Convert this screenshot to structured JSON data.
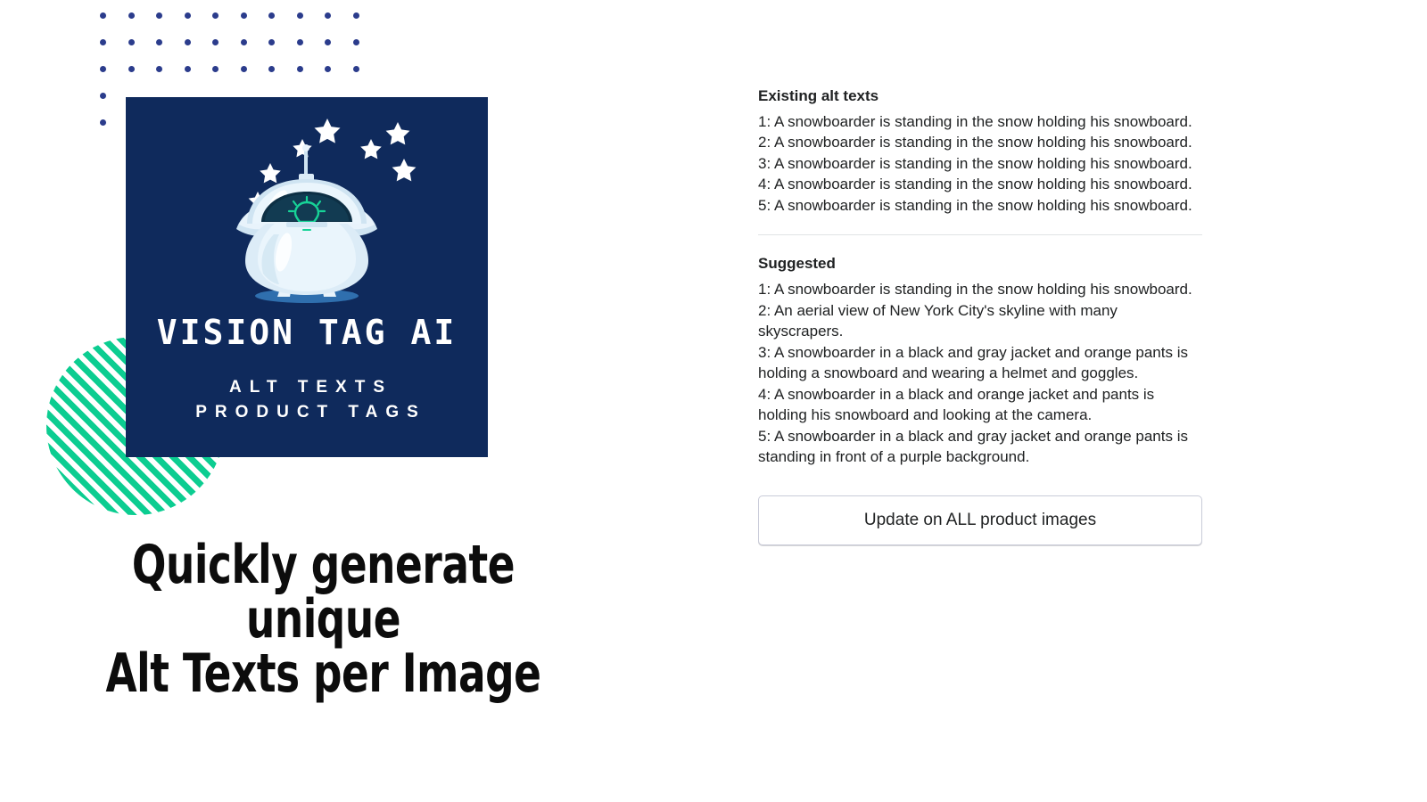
{
  "promo": {
    "card": {
      "title": "VISION TAG AI",
      "subtitle_line_1": "ALT TEXTS",
      "subtitle_line_2": "PRODUCT TAGS",
      "background_color": "#0f2a5c",
      "mascot": "robot-mascot-icon"
    },
    "decorations": {
      "dot_grid_color": "#2b3c8c",
      "striped_circle_color": "#0ccd91"
    },
    "headline_line_1": "Quickly generate unique",
    "headline_line_2": "Alt Texts per Image"
  },
  "alt_text_panel": {
    "existing": {
      "heading": "Existing alt texts",
      "items": [
        "1: A snowboarder is standing in the snow holding his snowboard.",
        "2: A snowboarder is standing in the snow holding his snowboard.",
        "3: A snowboarder is standing in the snow holding his snowboard.",
        "4: A snowboarder is standing in the snow holding his snowboard.",
        "5: A snowboarder is standing in the snow holding his snowboard."
      ]
    },
    "suggested": {
      "heading": "Suggested",
      "items": [
        "1: A snowboarder is standing in the snow holding his snowboard.",
        "2: An aerial view of New York City's skyline with many skyscrapers.",
        "3: A snowboarder in a black and gray jacket and orange pants is holding a snowboard and wearing a helmet and goggles.",
        "4: A snowboarder in a black and orange jacket and pants is holding his snowboard and looking at the camera.",
        "5: A snowboarder in a black and gray jacket and orange pants is standing in front of a purple background."
      ]
    },
    "update_button_label": "Update on ALL product images"
  }
}
